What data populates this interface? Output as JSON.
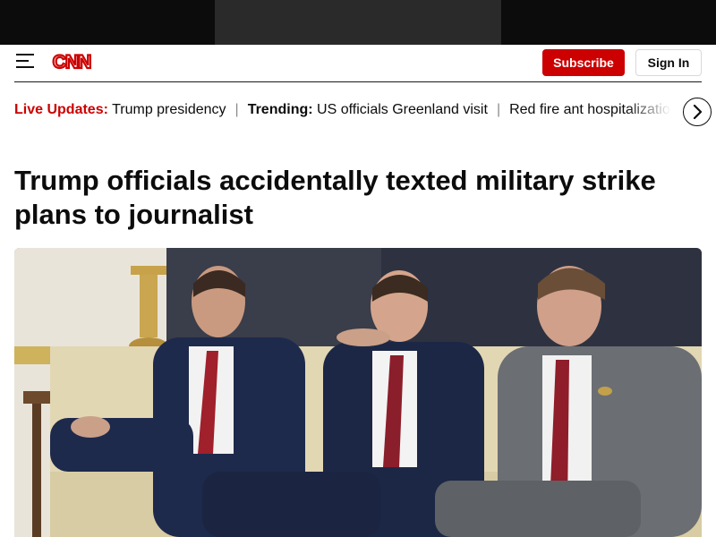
{
  "header": {
    "logo_text": "CNN",
    "subscribe_label": "Subscribe",
    "signin_label": "Sign In",
    "brand_color": "#cc0000"
  },
  "ticker": {
    "live_label": "Live Updates:",
    "live_link": "Trump presidency",
    "trending_label": "Trending:",
    "trending_link_1": "US officials Greenland visit",
    "trending_link_2": "Red fire ant hospitalization",
    "separator": "|"
  },
  "article": {
    "headline": "Trump officials accidentally texted military strike plans to journalist"
  },
  "icons": {
    "menu": "hamburger-menu-icon",
    "next": "chevron-right-icon"
  }
}
